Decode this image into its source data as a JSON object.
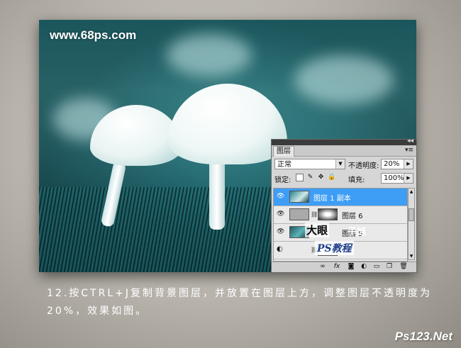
{
  "photo": {
    "watermark": "www.68ps.com"
  },
  "layers_panel": {
    "collapse_icon": "◂◂",
    "tab_label": "图层",
    "menu_icon": "▾≡",
    "blend_mode": "正常",
    "opacity_label": "不透明度:",
    "opacity_value": "20%",
    "lock_label": "锁定:",
    "fill_label": "填充:",
    "fill_value": "100%",
    "layers": [
      {
        "name": "图层 1 副本",
        "selected": true
      },
      {
        "name": "图层 6",
        "selected": false
      },
      {
        "name": "图层 5",
        "selected": false
      },
      {
        "name": "",
        "selected": false
      }
    ]
  },
  "overlay_watermark": {
    "line1": "大眼",
    "line2": "子旭",
    "line3": "PS教程"
  },
  "caption": {
    "line1": "12.按CTRL+J复制背景图层，并放置在图层上方，调整图层不透明度为",
    "line2": "20%，效果如图。"
  },
  "footer": {
    "site": "Ps123.Net"
  },
  "colors": {
    "selected_row": "#3e9df5",
    "panel_bg": "#d6d6d6"
  }
}
